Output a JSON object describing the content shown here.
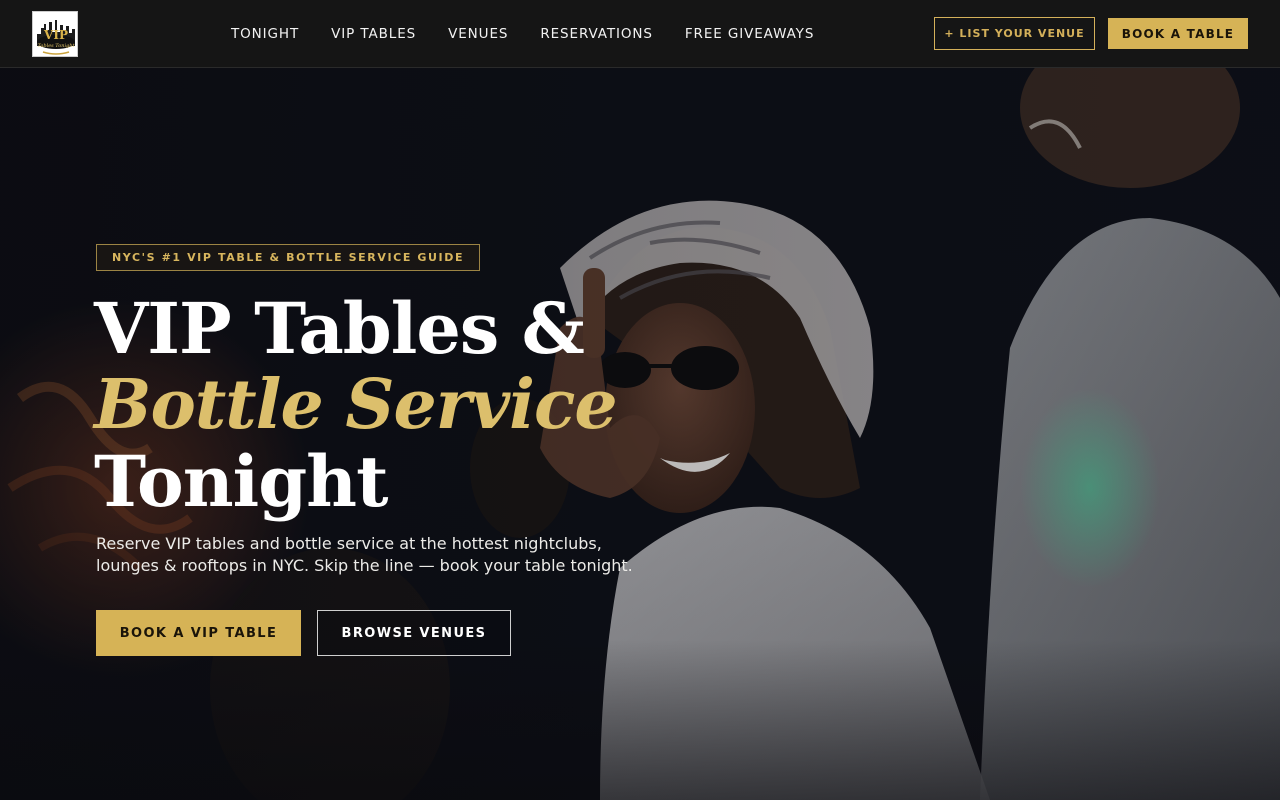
{
  "brand": {
    "logo_text_main": "VIP",
    "logo_text_sub": "Tables Tonight",
    "accent_color": "#d6b356"
  },
  "nav": {
    "items": [
      {
        "label": "TONIGHT"
      },
      {
        "label": "VIP TABLES"
      },
      {
        "label": "VENUES"
      },
      {
        "label": "RESERVATIONS"
      },
      {
        "label": "FREE GIVEAWAYS"
      }
    ],
    "list_venue_label": "+ LIST YOUR VENUE",
    "book_table_label": "BOOK A TABLE"
  },
  "hero": {
    "eyebrow": "NYC'S #1 VIP TABLE & BOTTLE SERVICE GUIDE",
    "headline_line1": "VIP Tables &",
    "headline_line2": "Bottle Service",
    "headline_line3": "Tonight",
    "subcopy_line1": "Reserve VIP tables and bottle service at the hottest nightclubs,",
    "subcopy_line2": "lounges & rooftops in NYC. Skip the line — book your table tonight.",
    "primary_cta": "BOOK A VIP TABLE",
    "secondary_cta": "BROWSE VENUES",
    "background_image": "nightclub-party-photo"
  }
}
